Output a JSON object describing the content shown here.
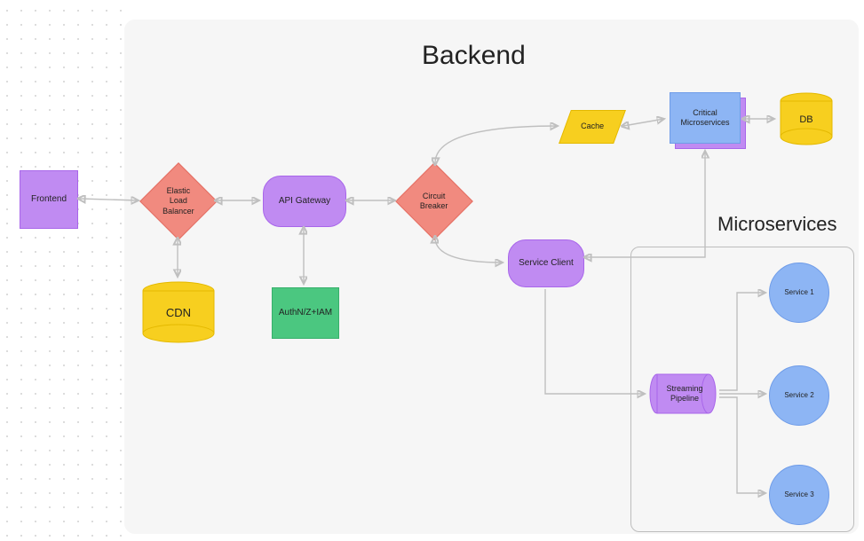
{
  "title": "Backend",
  "microservices_title": "Microservices",
  "nodes": {
    "frontend": "Frontend",
    "elastic_lb": "Elastic\nLoad\nBalancer",
    "api_gateway": "API Gateway",
    "circuit_breaker": "Circuit\nBreaker",
    "cache": "Cache",
    "critical_ms": "Critical\nMicroservices",
    "db": "DB",
    "service_client": "Service Client",
    "cdn": "CDN",
    "authn": "AuthN/Z+IAM",
    "streaming": "Streaming\nPipeline",
    "service1": "Service 1",
    "service2": "Service 2",
    "service3": "Service 3"
  },
  "colors": {
    "purple": "#c08bf2",
    "red": "#f18a7f",
    "green": "#4bc780",
    "yellow": "#f7cf1f",
    "blue": "#8db5f4",
    "grey": "#bfbfbf"
  },
  "edges": [
    [
      "frontend",
      "elastic_lb",
      "bi"
    ],
    [
      "elastic_lb",
      "api_gateway",
      "bi"
    ],
    [
      "elastic_lb",
      "cdn",
      "bi"
    ],
    [
      "api_gateway",
      "circuit_breaker",
      "bi"
    ],
    [
      "api_gateway",
      "authn",
      "bi"
    ],
    [
      "circuit_breaker",
      "cache",
      "bi"
    ],
    [
      "circuit_breaker",
      "service_client",
      "bi"
    ],
    [
      "cache",
      "critical_ms",
      "bi"
    ],
    [
      "critical_ms",
      "db",
      "bi"
    ],
    [
      "service_client",
      "critical_ms",
      "bi"
    ],
    [
      "service_client",
      "streaming",
      "fwd"
    ],
    [
      "streaming",
      "service1",
      "fwd"
    ],
    [
      "streaming",
      "service2",
      "fwd"
    ],
    [
      "streaming",
      "service3",
      "fwd"
    ]
  ]
}
